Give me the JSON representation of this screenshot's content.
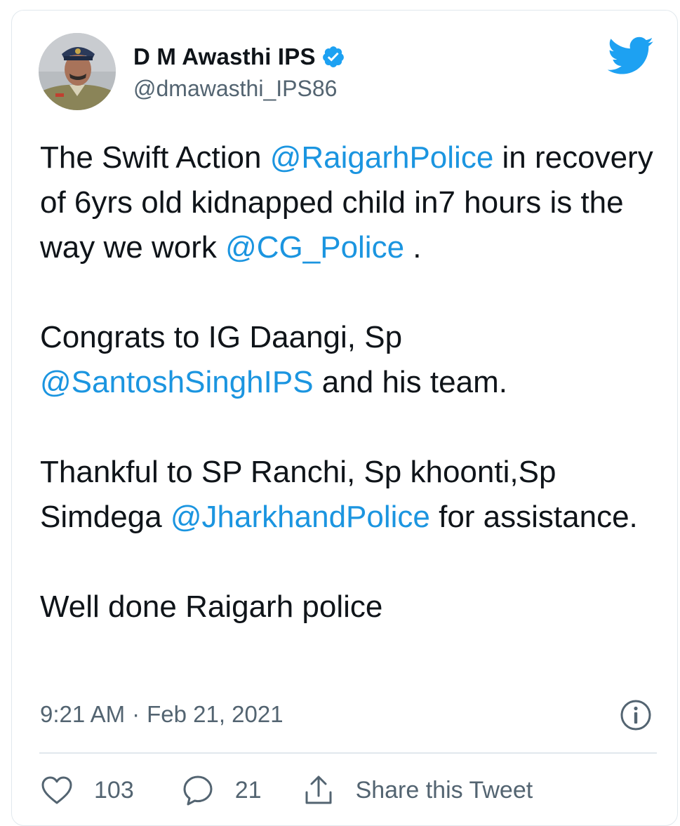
{
  "author": {
    "display_name": "D M Awasthi IPS",
    "handle": "@dmawasthi_IPS86",
    "verified": true
  },
  "tweet": {
    "paragraphs": [
      [
        {
          "text": "The Swift Action ",
          "mention": false
        },
        {
          "text": "@RaigarhPolice",
          "mention": true
        },
        {
          "text": " in recovery of 6yrs old kidnapped child in7 hours is the way we work ",
          "mention": false
        },
        {
          "text": "@CG_Police",
          "mention": true
        },
        {
          "text": " .",
          "mention": false
        }
      ],
      [
        {
          "text": "Congrats to IG Daangi, Sp ",
          "mention": false
        },
        {
          "text": "@SantoshSinghIPS",
          "mention": true
        },
        {
          "text": " and his team.",
          "mention": false
        }
      ],
      [
        {
          "text": "Thankful to SP Ranchi, Sp khoonti,Sp Simdega ",
          "mention": false
        },
        {
          "text": "@JharkhandPolice",
          "mention": true
        },
        {
          "text": " for assistance.",
          "mention": false
        }
      ],
      [
        {
          "text": "Well done Raigarh police",
          "mention": false
        }
      ]
    ]
  },
  "meta": {
    "time": "9:21 AM",
    "separator": "·",
    "date": "Feb 21, 2021"
  },
  "actions": {
    "likes": "103",
    "replies": "21",
    "share_label": "Share this Tweet"
  },
  "icons": {
    "like": "heart-icon",
    "reply": "speech-bubble-icon",
    "share": "share-upload-icon",
    "info": "info-icon",
    "brand": "twitter-bird-icon",
    "verified": "verified-badge-icon"
  },
  "colors": {
    "mention": "#1b95e0",
    "brand": "#1da1f2",
    "secondary_text": "#536471",
    "primary_text": "#0f1419"
  }
}
